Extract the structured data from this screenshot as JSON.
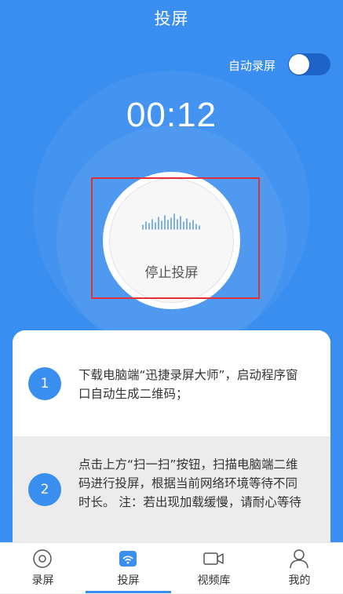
{
  "header": {
    "title": "投屏"
  },
  "auto_record": {
    "label": "自动录屏",
    "enabled": true
  },
  "timer": {
    "value": "00:12"
  },
  "stop_button": {
    "label": "停止投屏"
  },
  "steps": [
    {
      "number": "1",
      "text": "下载电脑端“迅捷录屏大师”，启动程序窗口自动生成二维码；"
    },
    {
      "number": "2",
      "text": "点击上方“扫一扫”按钮，扫描电脑端二维码进行投屏，根据当前网络环境等待不同时长。 注：若出现加载缓慢，请耐心等待"
    }
  ],
  "tabbar": {
    "items": [
      {
        "label": "录屏",
        "icon": "record-icon",
        "active": false
      },
      {
        "label": "投屏",
        "icon": "cast-icon",
        "active": true
      },
      {
        "label": "视频库",
        "icon": "video-icon",
        "active": false
      },
      {
        "label": "我的",
        "icon": "user-icon",
        "active": false
      }
    ]
  },
  "colors": {
    "primary": "#3a8ef0",
    "highlight": "#e0303a",
    "toggle_track": "#1e63c8"
  }
}
